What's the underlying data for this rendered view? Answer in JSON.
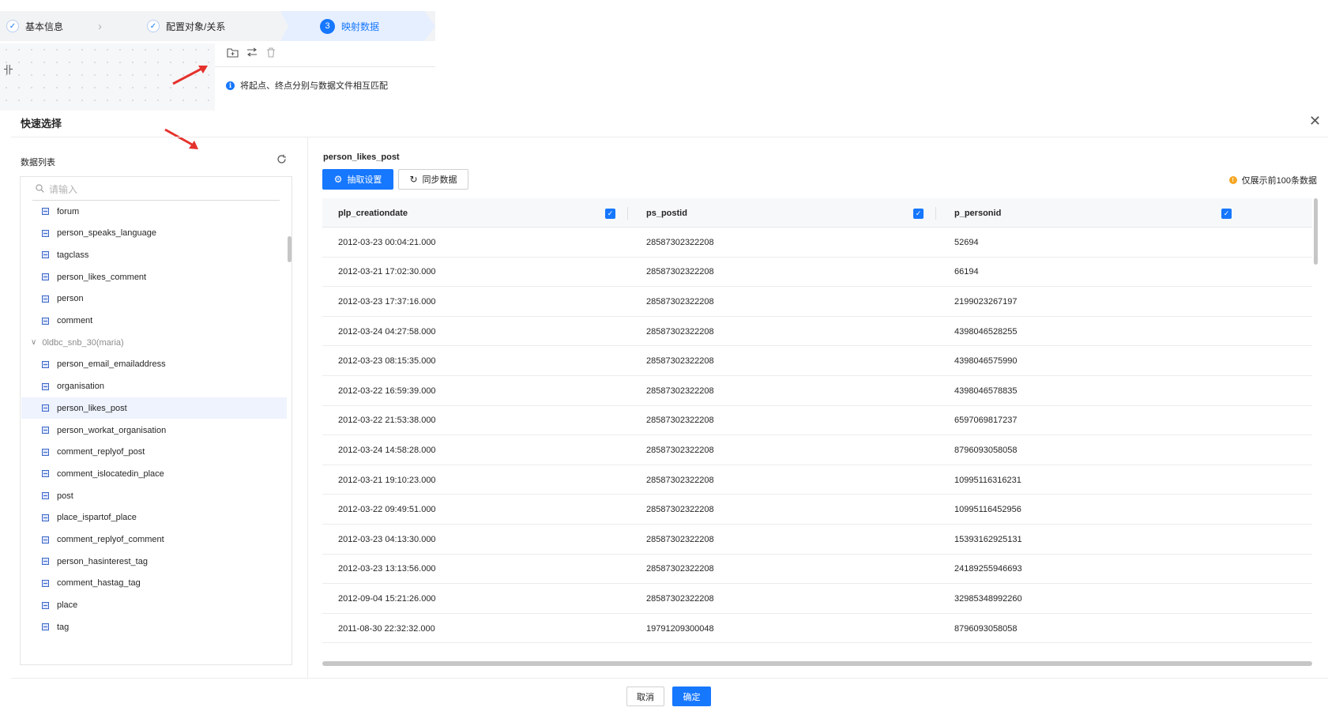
{
  "steps": [
    {
      "label": "基本信息",
      "state": "done"
    },
    {
      "label": "配置对象/关系",
      "state": "done"
    },
    {
      "label": "映射数据",
      "state": "active",
      "number": "3"
    }
  ],
  "hint": "将起点、终点分别与数据文件相互匹配",
  "toolbar_icons": [
    "add-folder-icon",
    "swap-icon",
    "trash-icon"
  ],
  "drawer": {
    "title": "快速选择",
    "close_icon": "close-icon"
  },
  "left": {
    "label": "数据列表",
    "search_placeholder": "请输入",
    "items": [
      {
        "label": "forum",
        "kind": "table"
      },
      {
        "label": "person_speaks_language",
        "kind": "table"
      },
      {
        "label": "tagclass",
        "kind": "table"
      },
      {
        "label": "person_likes_comment",
        "kind": "table"
      },
      {
        "label": "person",
        "kind": "table"
      },
      {
        "label": "comment",
        "kind": "table"
      },
      {
        "label": "0ldbc_snb_30(maria)",
        "kind": "group"
      },
      {
        "label": "person_email_emailaddress",
        "kind": "table"
      },
      {
        "label": "organisation",
        "kind": "table"
      },
      {
        "label": "person_likes_post",
        "kind": "table",
        "selected": true
      },
      {
        "label": "person_workat_organisation",
        "kind": "table"
      },
      {
        "label": "comment_replyof_post",
        "kind": "table"
      },
      {
        "label": "comment_islocatedin_place",
        "kind": "table"
      },
      {
        "label": "post",
        "kind": "table"
      },
      {
        "label": "place_ispartof_place",
        "kind": "table"
      },
      {
        "label": "comment_replyof_comment",
        "kind": "table"
      },
      {
        "label": "person_hasinterest_tag",
        "kind": "table"
      },
      {
        "label": "comment_hastag_tag",
        "kind": "table"
      },
      {
        "label": "place",
        "kind": "table"
      },
      {
        "label": "tag",
        "kind": "table"
      }
    ]
  },
  "right": {
    "table_name": "person_likes_post",
    "extract_button": "抽取设置",
    "sync_button": "同步数据",
    "notice": "仅展示前100条数据",
    "columns": [
      "plp_creationdate",
      "ps_postid",
      "p_personid"
    ],
    "rows": [
      [
        "2012-03-23 00:04:21.000",
        "28587302322208",
        "52694"
      ],
      [
        "2012-03-21 17:02:30.000",
        "28587302322208",
        "66194"
      ],
      [
        "2012-03-23 17:37:16.000",
        "28587302322208",
        "2199023267197"
      ],
      [
        "2012-03-24 04:27:58.000",
        "28587302322208",
        "4398046528255"
      ],
      [
        "2012-03-23 08:15:35.000",
        "28587302322208",
        "4398046575990"
      ],
      [
        "2012-03-22 16:59:39.000",
        "28587302322208",
        "4398046578835"
      ],
      [
        "2012-03-22 21:53:38.000",
        "28587302322208",
        "6597069817237"
      ],
      [
        "2012-03-24 14:58:28.000",
        "28587302322208",
        "8796093058058"
      ],
      [
        "2012-03-21 19:10:23.000",
        "28587302322208",
        "10995116316231"
      ],
      [
        "2012-03-22 09:49:51.000",
        "28587302322208",
        "10995116452956"
      ],
      [
        "2012-03-23 04:13:30.000",
        "28587302322208",
        "15393162925131"
      ],
      [
        "2012-03-23 13:13:56.000",
        "28587302322208",
        "24189255946693"
      ],
      [
        "2012-09-04 15:21:26.000",
        "28587302322208",
        "32985348992260"
      ],
      [
        "2011-08-30 22:32:32.000",
        "19791209300048",
        "8796093058058"
      ]
    ]
  },
  "footer": {
    "cancel": "取消",
    "ok": "确定"
  },
  "colors": {
    "primary": "#1677ff",
    "warning": "#f5a623",
    "annotation": "#e5322d",
    "selected_row": "#eef3fd"
  }
}
